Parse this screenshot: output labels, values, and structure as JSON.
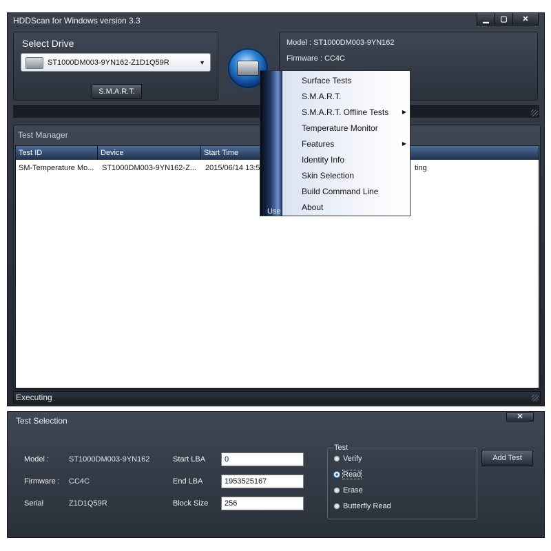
{
  "window": {
    "title": "HDDScan for Windows version 3.3",
    "buttons": {
      "minimize": "▁",
      "maximize": "▢",
      "close": "✕"
    }
  },
  "select_drive": {
    "title": "Select Drive",
    "selected_drive": "ST1000DM003-9YN162-Z1D1Q59R",
    "smart_button": "S.M.A.R.T."
  },
  "model_info": {
    "model_line": "Model : ST1000DM003-9YN162",
    "firmware_line": "Firmware : CC4C"
  },
  "test_manager": {
    "title": "Test Manager",
    "columns": [
      "Test ID",
      "Device",
      "Start Time",
      ""
    ],
    "rows": [
      {
        "test_id": "SM-Temperature Mo...",
        "device": "ST1000DM003-9YN162-Z...",
        "start_time": "2015/06/14 13:5",
        "state": "ting"
      }
    ]
  },
  "status": {
    "executing": "Executing"
  },
  "context_menu": {
    "side_label": "Use",
    "items": [
      {
        "label": "Surface Tests",
        "submenu": false
      },
      {
        "label": "S.M.A.R.T.",
        "submenu": false
      },
      {
        "label": "S.M.A.R.T. Offline Tests",
        "submenu": true
      },
      {
        "label": "Temperature Monitor",
        "submenu": false
      },
      {
        "label": "Features",
        "submenu": true
      },
      {
        "label": "Identity Info",
        "submenu": false
      },
      {
        "label": "Skin Selection",
        "submenu": false
      },
      {
        "label": "Build Command Line",
        "submenu": false
      },
      {
        "label": "About",
        "submenu": false
      }
    ]
  },
  "test_selection": {
    "title": "Test Selection",
    "close": "✕",
    "model_label": "Model :",
    "model_value": "ST1000DM003-9YN162",
    "firmware_label": "Firmware :",
    "firmware_value": "CC4C",
    "serial_label": "Serial",
    "serial_value": "Z1D1Q59R",
    "start_lba_label": "Start LBA",
    "start_lba_value": "0",
    "end_lba_label": "End LBA",
    "end_lba_value": "1953525167",
    "block_size_label": "Block Size",
    "block_size_value": "256",
    "test_group_label": "Test",
    "test_options": [
      "Verify",
      "Read",
      "Erase",
      "Butterfly Read"
    ],
    "selected_test": "Read",
    "add_test_button": "Add Test"
  }
}
